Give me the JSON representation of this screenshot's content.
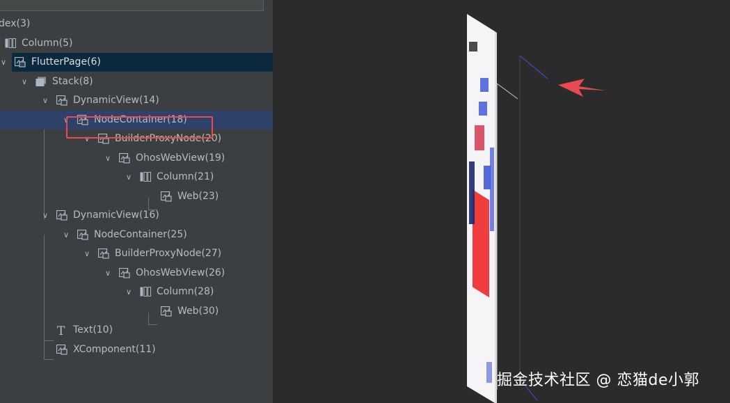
{
  "tree": {
    "nodes": [
      {
        "label": "dex(3)",
        "icon": "none",
        "expanded": false
      },
      {
        "label": "Column(5)",
        "icon": "column-icon",
        "expanded": false
      },
      {
        "label": "FlutterPage(6)",
        "icon": "component-icon",
        "expanded": true,
        "selected": true
      },
      {
        "label": "Stack(8)",
        "icon": "stack-icon",
        "expanded": true
      },
      {
        "label": "DynamicView(14)",
        "icon": "component-icon",
        "expanded": true
      },
      {
        "label": "NodeContainer(18)",
        "icon": "component-icon",
        "expanded": true,
        "hovered": true,
        "highlighted": true
      },
      {
        "label": "BuilderProxyNode(20)",
        "icon": "component-icon",
        "expanded": true
      },
      {
        "label": "OhosWebView(19)",
        "icon": "component-icon",
        "expanded": true
      },
      {
        "label": "Column(21)",
        "icon": "column-icon",
        "expanded": true
      },
      {
        "label": "Web(23)",
        "icon": "component-icon",
        "leaf": true
      },
      {
        "label": "DynamicView(16)",
        "icon": "component-icon",
        "expanded": true
      },
      {
        "label": "NodeContainer(25)",
        "icon": "component-icon",
        "expanded": true
      },
      {
        "label": "BuilderProxyNode(27)",
        "icon": "component-icon",
        "expanded": true
      },
      {
        "label": "OhosWebView(26)",
        "icon": "component-icon",
        "expanded": true
      },
      {
        "label": "Column(28)",
        "icon": "column-icon",
        "expanded": true
      },
      {
        "label": "Web(30)",
        "icon": "component-icon",
        "leaf": true
      },
      {
        "label": "Text(10)",
        "icon": "text-icon",
        "leaf": true
      },
      {
        "label": "XComponent(11)",
        "icon": "component-icon",
        "leaf": true
      }
    ]
  },
  "viewport": {
    "watermark": "掘金技术社区 @ 恋猫de小郭",
    "arrow_color": "#e84a4f",
    "phone_red": "#f03c3c",
    "phone_blue": "#3b4fd6"
  },
  "colors": {
    "panel_bg": "#3c3f41",
    "selected_bg": "#0d293e",
    "hovered_bg": "#2f4169",
    "highlight_border": "#e84a4f",
    "text": "#bbbbbb"
  }
}
